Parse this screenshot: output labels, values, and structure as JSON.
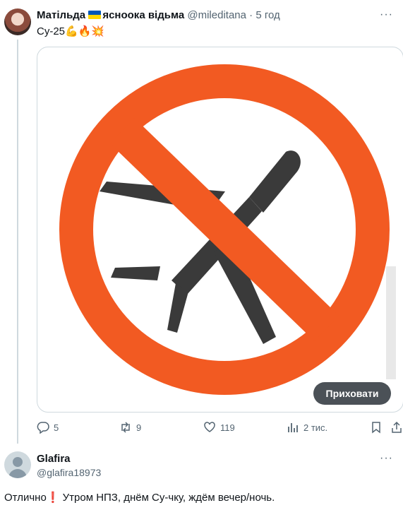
{
  "tweet1": {
    "author_name_part1": "Матільда",
    "author_name_part2": "ясноока відьма",
    "handle": "@mileditana",
    "time": "· 5 год",
    "text": "Су-25",
    "emojis": [
      "flexed-biceps",
      "fire",
      "collision"
    ],
    "hide_button_label": "Приховати",
    "stats": {
      "replies": "5",
      "retweets": "9",
      "likes": "119",
      "views": "2 тис."
    },
    "colors": {
      "prohibition_sign": "#f25a22",
      "plane": "#3a3a3a"
    }
  },
  "tweet2": {
    "author_name": "Glafira",
    "handle": "@glafira18973",
    "text": "Отлично❗ Утром НПЗ, днём Су-чку, ждём вечер/ночь."
  },
  "more_icon": "more-options-icon",
  "flag_colors": [
    "#0057b7",
    "#ffd700"
  ]
}
